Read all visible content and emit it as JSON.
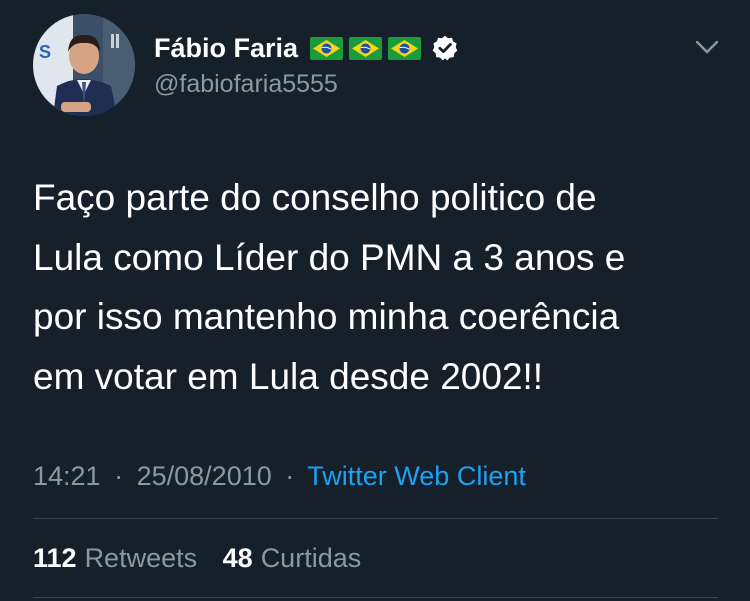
{
  "profile": {
    "display_name": "Fábio Faria",
    "handle": "@fabiofaria5555",
    "flag_icons": [
      "brazil-flag-icon",
      "brazil-flag-icon",
      "brazil-flag-icon"
    ],
    "verified_icon": "verified-badge-icon"
  },
  "tweet": {
    "lines": [
      "Faço parte do conselho politico de",
      "Lula como Líder do PMN a 3 anos e",
      "por isso mantenho minha coerência",
      "em votar em Lula desde 2002!!"
    ]
  },
  "meta": {
    "time": "14:21",
    "date": "25/08/2010",
    "separator": "·",
    "source": "Twitter Web Client"
  },
  "stats": {
    "retweets_count": "112",
    "retweets_label": "Retweets",
    "likes_count": "48",
    "likes_label": "Curtidas"
  },
  "colors": {
    "background": "#15202b",
    "secondary_text": "#8899a6",
    "link": "#1da1f2",
    "divider": "#38444d"
  }
}
